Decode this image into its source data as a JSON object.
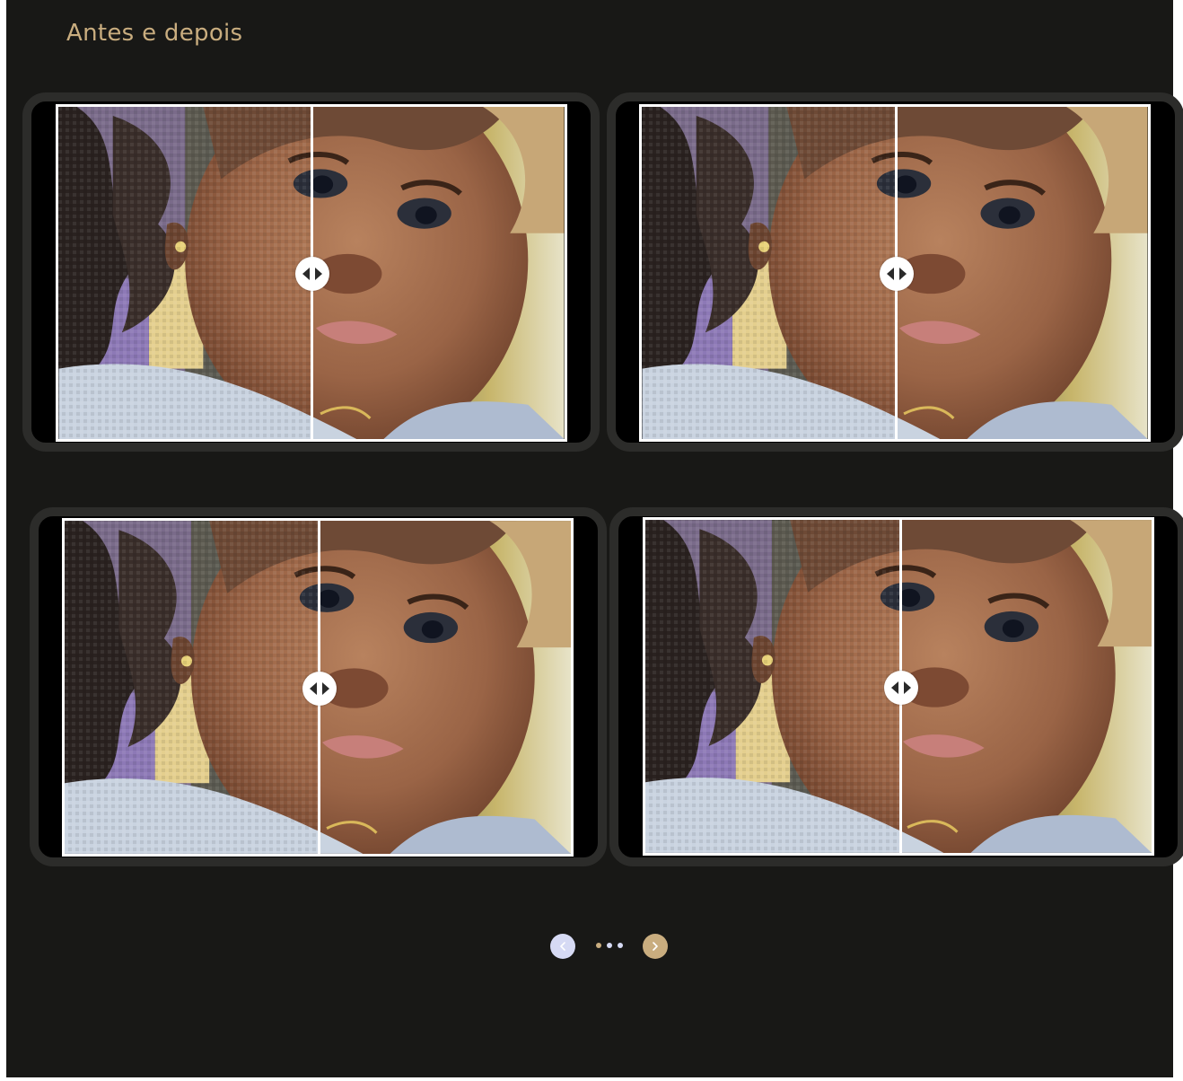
{
  "section": {
    "title": "Antes e depois",
    "title_color": "#c9ad7f",
    "background": "#181816"
  },
  "comparisons": [
    {
      "before_label": "",
      "after_label": ""
    },
    {
      "before_label": "",
      "after_label": ""
    },
    {
      "before_label": "",
      "after_label": ""
    },
    {
      "before_label": "",
      "after_label": ""
    }
  ],
  "pagination": {
    "prev_icon": "chevron-left-icon",
    "next_icon": "chevron-right-icon",
    "prev_color": "#d6daf4",
    "next_color": "#c9ad7f",
    "dot_colors": [
      "#c9ad7f",
      "#d6daf4",
      "#d6daf4"
    ]
  },
  "colors": {
    "card_border": "#2c2c2a",
    "frame_border": "#ffffff"
  }
}
